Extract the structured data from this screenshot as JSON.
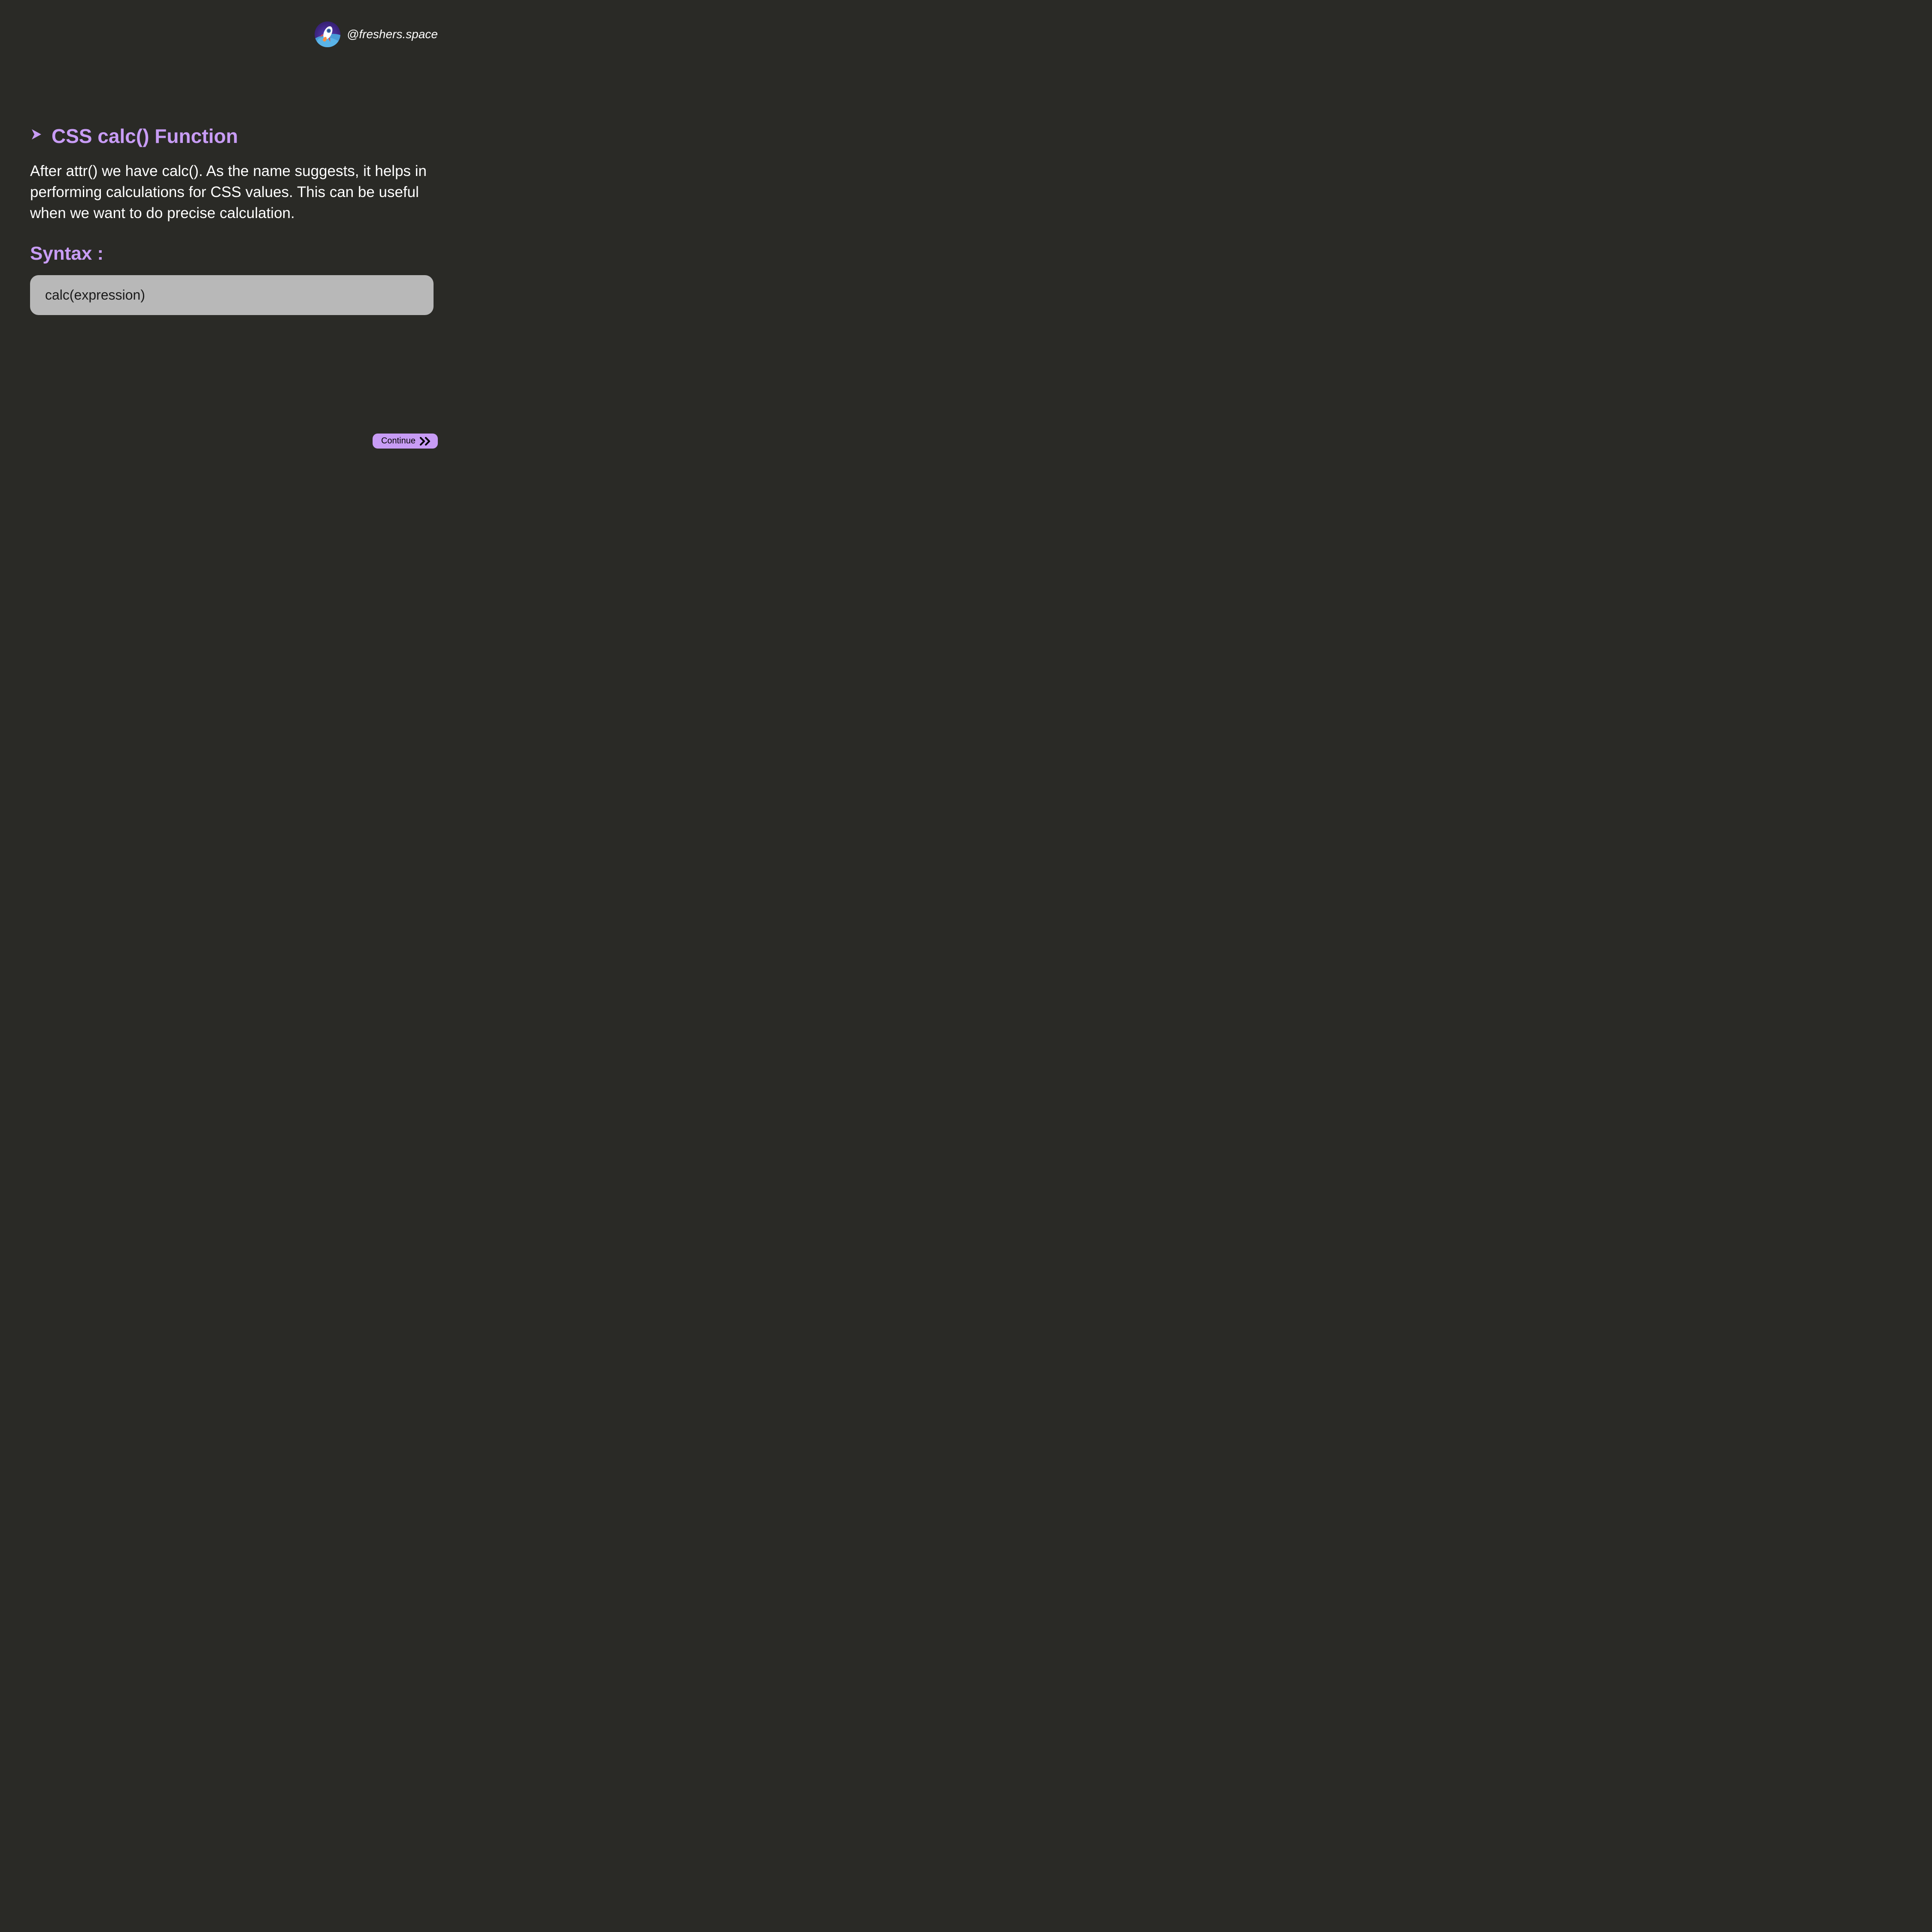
{
  "header": {
    "handle": "@freshers.space"
  },
  "content": {
    "title": "CSS calc() Function",
    "description": "After attr() we have calc(). As the name suggests, it helps in performing calculations for CSS values. This can be useful when we want to do precise calculation.",
    "syntax_label": "Syntax :",
    "code": "calc(expression)"
  },
  "footer": {
    "continue_label": "Continue"
  }
}
